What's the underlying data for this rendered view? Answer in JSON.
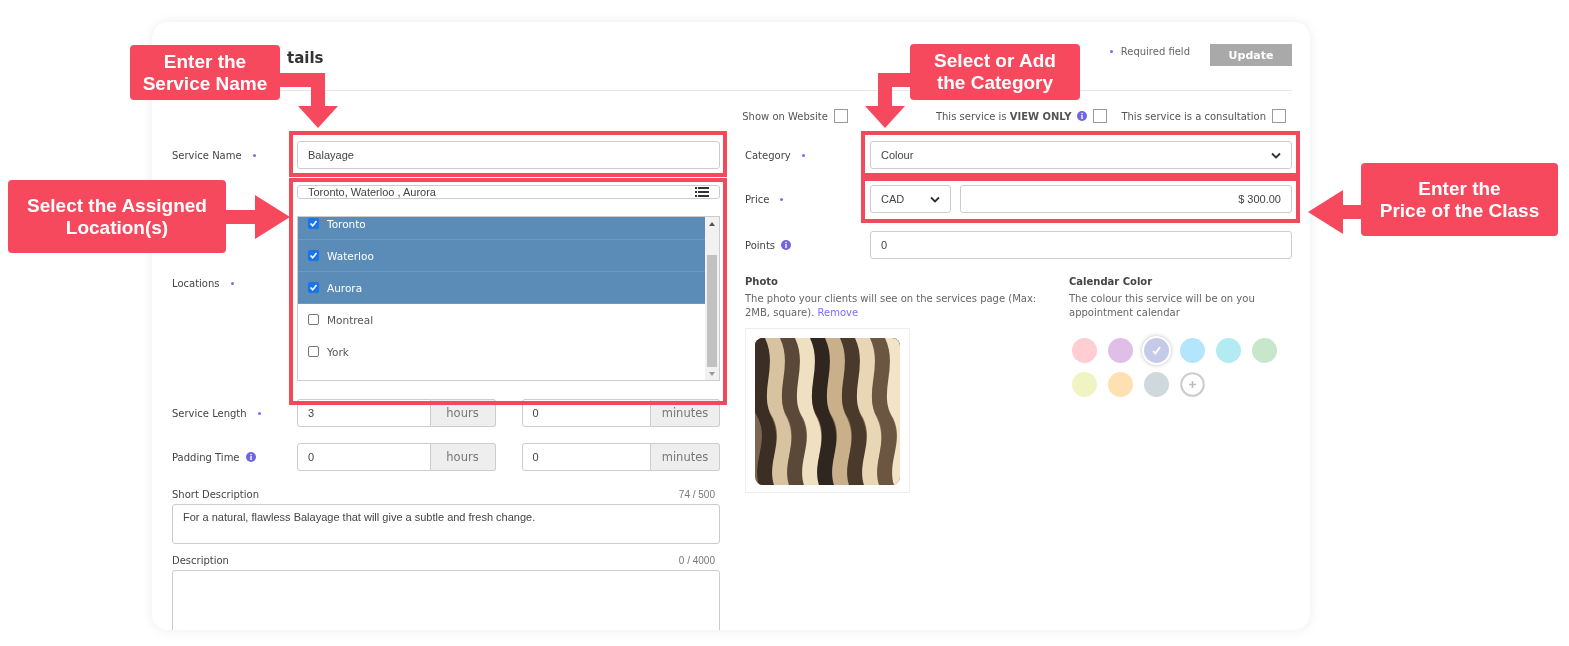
{
  "header": {
    "title": "tails",
    "required_note": "Required field",
    "update_button": "Update"
  },
  "options": [
    {
      "label": "Show on Website",
      "info": false,
      "checked": false
    },
    {
      "label": "This service is **VIEW ONLY**",
      "info": true,
      "checked": false
    },
    {
      "label": "This service is a consultation",
      "info": false,
      "checked": false
    }
  ],
  "service_name": {
    "label": "Service Name",
    "required": true,
    "value": "Balayage"
  },
  "locations": {
    "label": "Locations",
    "required": true,
    "value": "Toronto, Waterloo , Aurora",
    "items": [
      {
        "name": "Toronto",
        "checked": true
      },
      {
        "name": "Waterloo",
        "checked": true
      },
      {
        "name": "Aurora",
        "checked": true
      },
      {
        "name": "Montreal",
        "checked": false
      },
      {
        "name": "York",
        "checked": false
      }
    ]
  },
  "service_length": {
    "label": "Service Length",
    "required": true,
    "info": false,
    "hours": "3",
    "hours_unit": "hours",
    "minutes": "0",
    "minutes_unit": "minutes"
  },
  "padding_time": {
    "label": "Padding Time",
    "required": false,
    "info": true,
    "hours": "0",
    "hours_unit": "hours",
    "minutes": "0",
    "minutes_unit": "minutes"
  },
  "short_description": {
    "label": "Short Description",
    "count": "74 / 500",
    "value": "For a natural, flawless Balayage that will give a subtle and fresh change."
  },
  "description": {
    "label": "Description",
    "count": "0 / 4000"
  },
  "category": {
    "label": "Category",
    "required": true,
    "value": "Colour"
  },
  "price": {
    "label": "Price",
    "required": true,
    "currency": "CAD",
    "amount": "$ 300.00"
  },
  "points": {
    "label": "Points",
    "info": true,
    "value": "0"
  },
  "photo": {
    "label": "Photo",
    "help": "The photo your clients will see on the services page (Max: 2MB, square).",
    "remove_link": "Remove"
  },
  "calendar_color": {
    "label": "Calendar Color",
    "help": "The colour this service will be on you appointment calendar",
    "swatches": [
      {
        "color": "#ffcdd2",
        "selected": false
      },
      {
        "color": "#e1bee7",
        "selected": false
      },
      {
        "color": "#c5cae9",
        "selected": true
      },
      {
        "color": "#b3e5fc",
        "selected": false
      },
      {
        "color": "#b2ebf2",
        "selected": false
      },
      {
        "color": "#c8e6c9",
        "selected": false
      },
      {
        "color": "#f0f4c3",
        "selected": false
      },
      {
        "color": "#ffe0b2",
        "selected": false
      },
      {
        "color": "#cfd8dc",
        "selected": false
      }
    ]
  },
  "callouts": [
    {
      "text": "Enter the\nService Name",
      "kind": "down"
    },
    {
      "text": "Select the Assigned\nLocation(s)",
      "kind": "right"
    },
    {
      "text": "Select or Add\nthe Category",
      "kind": "downleft"
    },
    {
      "text": "Enter the\nPrice of the Class",
      "kind": "left"
    }
  ]
}
